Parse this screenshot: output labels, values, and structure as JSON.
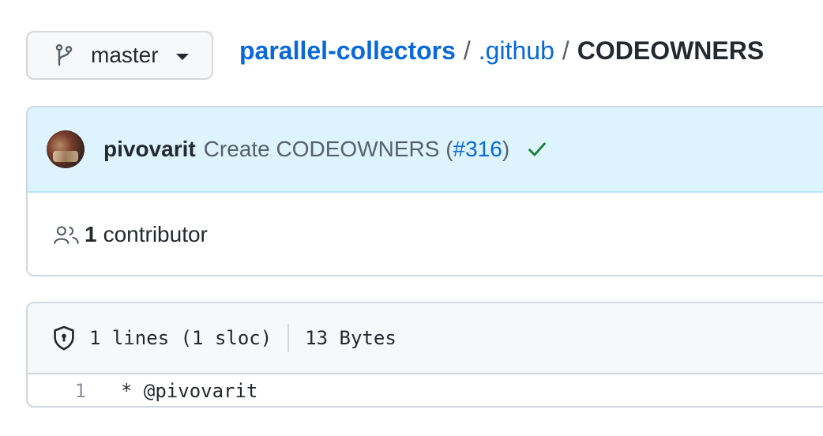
{
  "branch": {
    "name": "master",
    "icon": "git-branch-icon"
  },
  "breadcrumb": {
    "repo": "parallel-collectors",
    "sep1": "/",
    "dir": ".github",
    "sep2": "/",
    "file": "CODEOWNERS"
  },
  "commit": {
    "author": "pivovarit",
    "message_prefix": "Create CODEOWNERS (",
    "pr": "#316",
    "message_suffix": ")",
    "status_icon": "check-icon",
    "status_color": "#1a7f37"
  },
  "contributors": {
    "count": "1",
    "label": "contributor",
    "icon": "people-icon"
  },
  "file_info": {
    "lines": "1 lines (1 sloc)",
    "size": "13 Bytes",
    "icon": "shield-icon"
  },
  "code_lines": [
    {
      "number": "1",
      "text": "* @pivovarit"
    }
  ],
  "colors": {
    "link": "#0969da",
    "commit_bg": "#ddf4ff",
    "header_bg": "#f6f8fa"
  }
}
